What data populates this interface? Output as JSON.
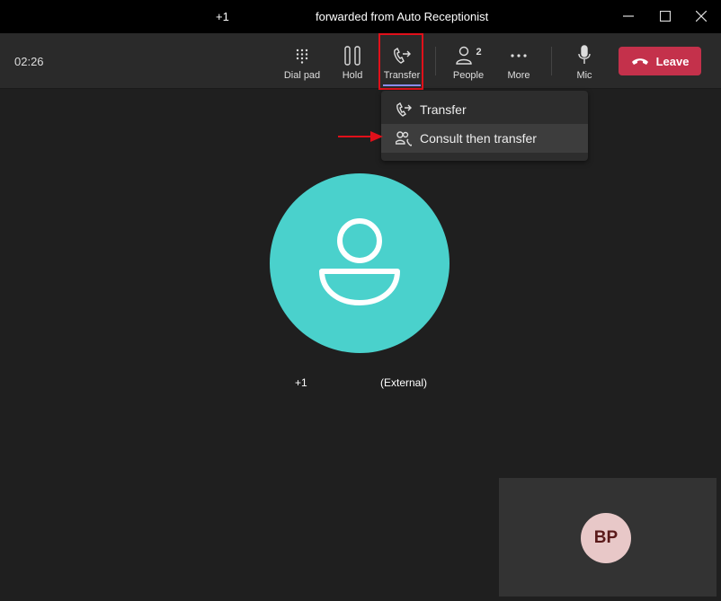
{
  "window": {
    "title_prefix": "+1",
    "title": "forwarded from Auto Receptionist"
  },
  "toolbar": {
    "timer": "02:26",
    "dialpad_label": "Dial pad",
    "hold_label": "Hold",
    "transfer_label": "Transfer",
    "people_label": "People",
    "people_count": "2",
    "more_label": "More",
    "mic_label": "Mic",
    "leave_label": "Leave"
  },
  "transfer_menu": {
    "items": [
      {
        "label": "Transfer",
        "icon": "phone-transfer-icon"
      },
      {
        "label": "Consult then transfer",
        "icon": "people-call-icon"
      }
    ]
  },
  "caller": {
    "number": "+1",
    "tag": "(External)",
    "avatar_color": "#4ad1cc"
  },
  "self": {
    "initials": "BP"
  },
  "colors": {
    "leave": "#c4314b",
    "highlight": "#e0101a",
    "accent": "#8b8cf0"
  }
}
